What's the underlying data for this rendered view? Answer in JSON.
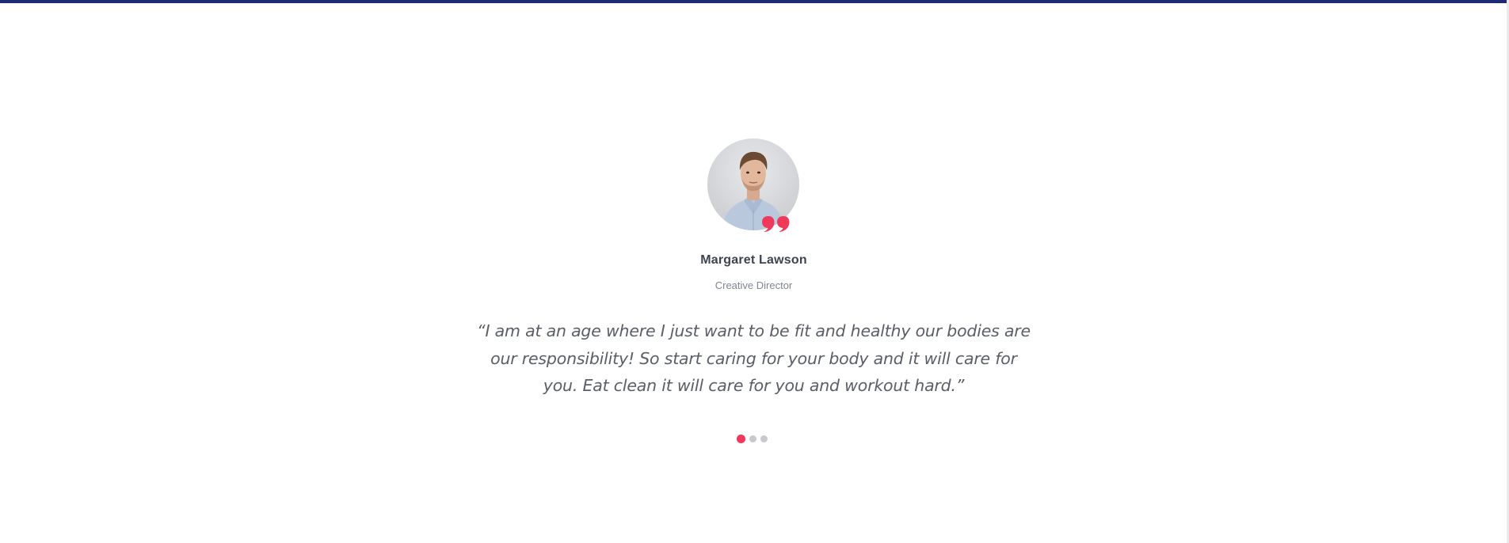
{
  "testimonial": {
    "name": "Margaret Lawson",
    "role": "Creative Director",
    "quote": "“I am at an age where I just want to be fit and healthy our bodies are our responsibility! So start caring for your body and it will care for you. Eat clean it will care for you and workout hard.”",
    "avatar_icon": "person-portrait-avatar",
    "quote_icon": "quote-marks-icon"
  },
  "pagination": {
    "count": 3,
    "active_index": 0
  },
  "colors": {
    "accent": "#f0385a",
    "top_bar": "#1d2a73",
    "name_text": "#3d4450",
    "role_text": "#7f8592",
    "quote_text": "#5a5e66",
    "inactive_dot": "#c7c9cd"
  }
}
